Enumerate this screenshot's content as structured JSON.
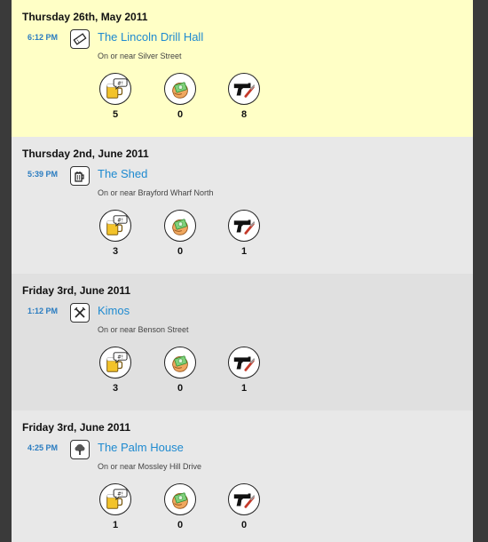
{
  "colors": {
    "highlight_bg": "#ffffc6",
    "card_bg_light": "#e8e8e8",
    "card_bg_dark": "#e0e0e0",
    "link": "#1e8ad0",
    "time": "#2a7cc0"
  },
  "stat_icons": [
    "beer-speech-icon",
    "money-hand-icon",
    "gun-knife-icon"
  ],
  "checkins": [
    {
      "date": "Thursday 26th, May 2011",
      "time": "6:12 PM",
      "venue_icon": "ticket-icon",
      "venue": "The Lincoln Drill Hall",
      "location": "On or near Silver Street",
      "stats": [
        "5",
        "0",
        "8"
      ],
      "highlighted": true
    },
    {
      "date": "Thursday 2nd, June 2011",
      "time": "5:39 PM",
      "venue_icon": "beer-mug-icon",
      "venue": "The Shed",
      "location": "On or near Brayford Wharf North",
      "stats": [
        "3",
        "0",
        "1"
      ],
      "highlighted": false
    },
    {
      "date": "Friday 3rd, June 2011",
      "time": "1:12 PM",
      "venue_icon": "fork-knife-icon",
      "venue": "Kimos",
      "location": "On or near Benson Street",
      "stats": [
        "3",
        "0",
        "1"
      ],
      "highlighted": false
    },
    {
      "date": "Friday 3rd, June 2011",
      "time": "4:25 PM",
      "venue_icon": "tree-icon",
      "venue": "The Palm House",
      "location": "On or near Mossley Hill Drive",
      "stats": [
        "1",
        "0",
        "0"
      ],
      "highlighted": false
    }
  ]
}
